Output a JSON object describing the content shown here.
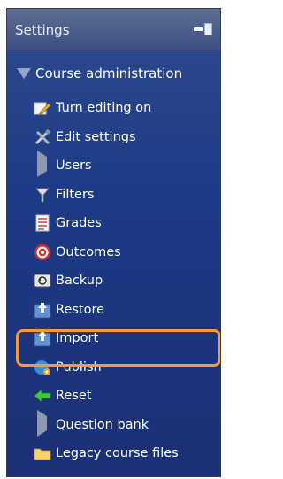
{
  "block": {
    "title": "Settings",
    "root_label": "Course administration"
  },
  "items": [
    {
      "label": "Turn editing on",
      "icon": "edit-pencil-icon"
    },
    {
      "label": "Edit settings",
      "icon": "tools-icon"
    },
    {
      "label": "Users",
      "icon": "expand-arrow-icon"
    },
    {
      "label": "Filters",
      "icon": "filter-funnel-icon"
    },
    {
      "label": "Grades",
      "icon": "grades-sheet-icon"
    },
    {
      "label": "Outcomes",
      "icon": "target-icon"
    },
    {
      "label": "Backup",
      "icon": "backup-icon"
    },
    {
      "label": "Restore",
      "icon": "restore-icon"
    },
    {
      "label": "Import",
      "icon": "import-icon"
    },
    {
      "label": "Publish",
      "icon": "publish-icon"
    },
    {
      "label": "Reset",
      "icon": "reset-arrow-icon"
    },
    {
      "label": "Question bank",
      "icon": "expand-arrow-icon"
    },
    {
      "label": "Legacy course files",
      "icon": "folder-icon"
    }
  ],
  "colors": {
    "panel": "#1d3a86",
    "header": "#4a5a88",
    "highlight": "#f59a35"
  }
}
